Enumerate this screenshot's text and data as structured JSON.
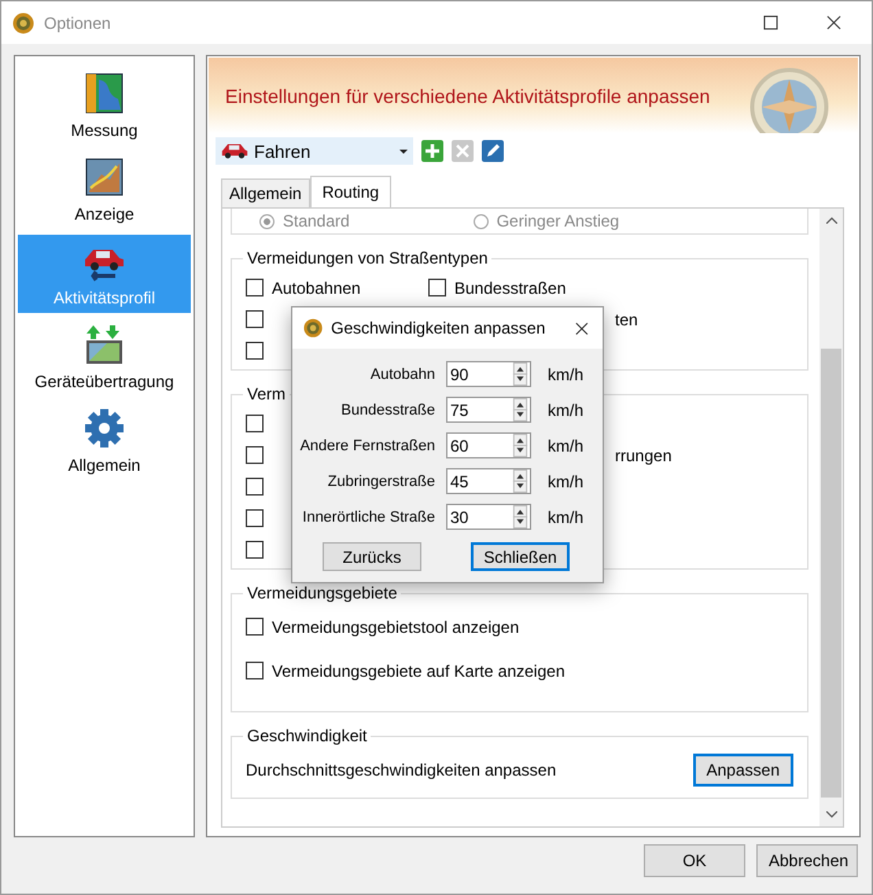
{
  "window": {
    "title": "Optionen"
  },
  "sidebar": {
    "items": [
      {
        "label": "Messung",
        "selected": false
      },
      {
        "label": "Anzeige",
        "selected": false
      },
      {
        "label": "Aktivitätsprofil",
        "selected": true
      },
      {
        "label": "Geräteübertragung",
        "selected": false
      },
      {
        "label": "Allgemein",
        "selected": false
      }
    ]
  },
  "banner": {
    "title": "Einstellungen für verschiedene Aktivitätsprofile anpassen"
  },
  "profile": {
    "value": "Fahren"
  },
  "tabs": [
    {
      "label": "Allgemein",
      "selected": false
    },
    {
      "label": "Routing",
      "selected": true
    }
  ],
  "top_radios": [
    {
      "label": "Standard",
      "selected": true
    },
    {
      "label": "Geringer Anstieg",
      "selected": false
    }
  ],
  "groups": [
    {
      "title": "Vermeidungen von Straßentypen",
      "kind": "columns",
      "left": [
        {
          "kind": "checkbox",
          "label": "Autobahnen",
          "checked": false
        },
        {
          "kind": "checkbox",
          "checked": false
        },
        {
          "kind": "checkbox",
          "checked": false
        }
      ],
      "right": [
        {
          "kind": "checkbox",
          "label": "Bundesstraßen",
          "checked": false
        },
        {
          "kind": "fragment",
          "label": "ten"
        }
      ]
    },
    {
      "title": "Verm",
      "kind": "columns",
      "left": [
        {
          "kind": "checkbox",
          "checked": false
        },
        {
          "kind": "checkbox",
          "checked": false
        },
        {
          "kind": "checkbox",
          "checked": false
        },
        {
          "kind": "checkbox",
          "checked": false
        },
        {
          "kind": "checkbox",
          "checked": false
        }
      ],
      "right": [
        {
          "kind": "hidden"
        },
        {
          "kind": "fragment",
          "label": "rrungen"
        }
      ]
    },
    {
      "title": "Vermeidungsgebiete",
      "kind": "list",
      "left": [
        {
          "kind": "checkbox",
          "label": "Vermeidungsgebietstool anzeigen",
          "checked": false
        },
        {
          "kind": "checkbox",
          "label": "Vermeidungsgebiete auf Karte anzeigen",
          "checked": false
        }
      ]
    }
  ],
  "speed_group": {
    "title": "Geschwindigkeit",
    "text": "Durchschnittsgeschwindigkeiten anpassen",
    "button": "Anpassen"
  },
  "footer": {
    "buttons": [
      "OK",
      "Abbrechen"
    ]
  },
  "dialog": {
    "title": "Geschwindigkeiten anpassen",
    "rows": [
      {
        "label": "Autobahn",
        "value": "90",
        "unit": "km/h"
      },
      {
        "label": "Bundesstraße",
        "value": "75",
        "unit": "km/h"
      },
      {
        "label": "Andere Fernstraßen",
        "value": "60",
        "unit": "km/h"
      },
      {
        "label": "Zubringerstraße",
        "value": "45",
        "unit": "km/h"
      },
      {
        "label": "Innerörtliche Straße",
        "value": "30",
        "unit": "km/h"
      }
    ],
    "buttons": [
      {
        "label": "Zurücks",
        "focused": false
      },
      {
        "label": "Schließen",
        "focused": true
      }
    ]
  }
}
